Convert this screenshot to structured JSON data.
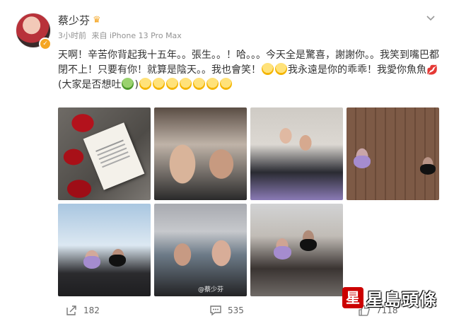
{
  "user": {
    "name": "蔡少芬",
    "time": "3小时前",
    "source": "来自 iPhone 13 Pro Max"
  },
  "post": {
    "text_1": "天啊！辛苦你背起我十五年。。張生。。！哈。。。今天全是驚喜，謝謝你。。我笑到嘴巴都閉不上！只要有你！就算是陰天。。我也會笑！",
    "text_2": "我永遠是你的乖乖！我愛你魚魚",
    "text_3": "(大家是否想吐",
    "text_4": ")"
  },
  "photos": {
    "watermark": "@蔡少芬"
  },
  "actions": {
    "share_count": "182",
    "comment_count": "535",
    "like_count": "7118"
  },
  "watermark_logo": {
    "text": "星島頭條",
    "mark": "星"
  },
  "colors": {
    "accent": "#f5a623",
    "text": "#333333",
    "muted": "#939393",
    "logo_red": "#cc0000"
  },
  "icons": [
    "crown-icon",
    "verified-badge-icon",
    "chevron-down-icon",
    "share-icon",
    "comment-icon",
    "like-icon"
  ]
}
